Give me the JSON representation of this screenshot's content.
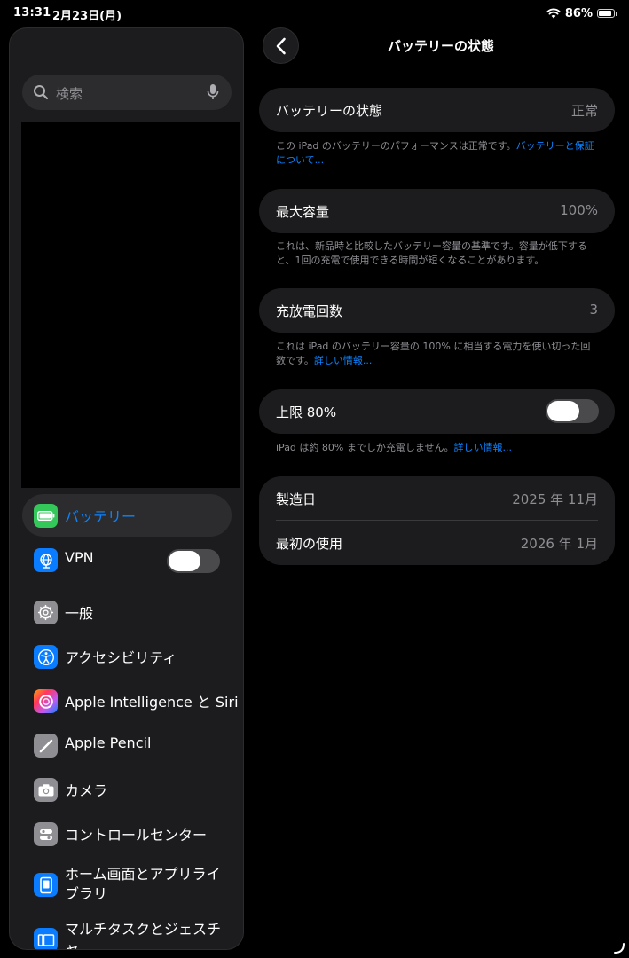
{
  "status_bar": {
    "time": "13:31",
    "date": "2月23日(月)",
    "battery_percent": "86%",
    "battery_level": 0.86
  },
  "sidebar": {
    "search": {
      "placeholder": "検索"
    },
    "items": [
      {
        "key": "battery",
        "label": "バッテリー",
        "icon": "battery-icon",
        "color": "#34c759",
        "selected": true
      },
      {
        "key": "vpn",
        "label": "VPN",
        "icon": "vpn-globe-icon",
        "color": "#0a7cff",
        "toggle_on": false
      },
      {
        "key": "general",
        "label": "一般",
        "icon": "gear-icon",
        "color": "#8e8e93"
      },
      {
        "key": "accessibility",
        "label": "アクセシビリティ",
        "icon": "accessibility-icon",
        "color": "#0a7cff"
      },
      {
        "key": "apple-intelligence",
        "label": "Apple Intelligence と Siri",
        "icon": "apple-intelligence-icon",
        "color": "#ff6b6b"
      },
      {
        "key": "apple-pencil",
        "label": "Apple Pencil",
        "icon": "pencil-icon",
        "color": "#8e8e93"
      },
      {
        "key": "camera",
        "label": "カメラ",
        "icon": "camera-icon",
        "color": "#8e8e93"
      },
      {
        "key": "control-center",
        "label": "コントロールセンター",
        "icon": "control-center-icon",
        "color": "#8e8e93"
      },
      {
        "key": "home-screen",
        "label": "ホーム画面とアプリライブラリ",
        "icon": "home-screen-icon",
        "color": "#0a7cff"
      },
      {
        "key": "multitasking",
        "label": "マルチタスクとジェスチャ",
        "icon": "multitasking-icon",
        "color": "#0a7cff"
      }
    ]
  },
  "detail": {
    "title": "バッテリーの状態",
    "health": {
      "label": "バッテリーの状態",
      "value": "正常",
      "footnote": "この iPad のバッテリーのパフォーマンスは正常です。",
      "link": "バッテリーと保証について..."
    },
    "max_capacity": {
      "label": "最大容量",
      "value": "100%",
      "footnote": "これは、新品時と比較したバッテリー容量の基準です。容量が低下すると、1回の充電で使用できる時間が短くなることがあります。"
    },
    "cycle_count": {
      "label": "充放電回数",
      "value": "3",
      "footnote": "これは iPad のバッテリー容量の 100% に相当する電力を使い切った回数です。",
      "link": "詳しい情報..."
    },
    "limit": {
      "label": "上限 80%",
      "toggle_on": false,
      "footnote": "iPad は約 80% までしか充電しません。",
      "link": "詳しい情報..."
    },
    "manufacture": {
      "label": "製造日",
      "value": "2025 年 11月"
    },
    "first_use": {
      "label": "最初の使用",
      "value": "2026 年 1月"
    }
  },
  "colors": {
    "accent": "#0a84ff",
    "background": "#000000",
    "card": "#1c1c1e",
    "secondary_text": "#8e8e93"
  }
}
